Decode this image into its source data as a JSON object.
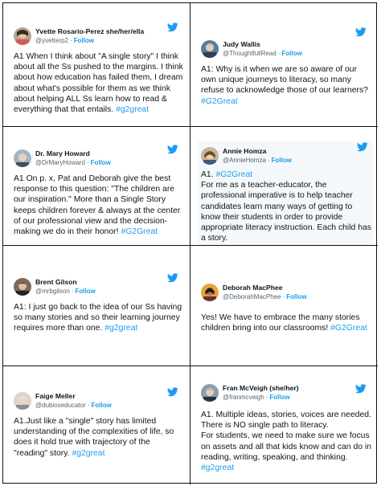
{
  "colors": {
    "link": "#1d9bf0",
    "handle": "#536471",
    "text": "#0f1419",
    "shaded_bg": "#f5f8fa"
  },
  "icons": {
    "brand": "twitter-bird-icon"
  },
  "follow_label": "Follow",
  "tweets": [
    {
      "name": "Yvette Rosario-Perez she/her/ella",
      "handle": "@yvetterp2",
      "body": "A1 When I think about \"A single story\" I think about all the Ss pushed to the margins. I think about how education has failed them, I dream about what's possible for them as we think about helping ALL Ss learn how to read & everything that that entails.",
      "tag": "#g2great"
    },
    {
      "name": "Judy Wallis",
      "handle": "@ThoughtfullRead",
      "body": "A1: Why is it when we are so aware of our own unique journeys to literacy, so many refuse to acknowledge those of our learners?",
      "tag": "#G2Great"
    },
    {
      "name": "Dr. Mary Howard",
      "handle": "@DrMaryHoward",
      "body": "A1 On p. x, Pat and Deborah give the best response to this question: \"The children are our inspiration.\" More than a Single Story keeps children forever & always at the center of our professional view and the decision-making we do in their honor!",
      "tag": "#G2Great"
    },
    {
      "name": "Annie Homza",
      "handle": "@AnnieHomza",
      "lead": "A1.",
      "tag": "#G2Great",
      "body": "For me as a teacher-educator, the professional imperative is to help teacher candidates learn many ways of getting to know their students in order to provide appropriate literacy instruction. Each child has a story."
    },
    {
      "name": "Brent Gilson",
      "handle": "@mrbgilson",
      "body": "A1: I just go back to the idea of our Ss having so many stories and so their learning journey requires more than one.",
      "tag": "#g2great"
    },
    {
      "name": "Deborah MacPhee",
      "handle": "@DeborahMacPhee",
      "body": "Yes! We have to embrace the many stories children bring into our classrooms!",
      "tag": "#G2Great"
    },
    {
      "name": "Faige Meller",
      "handle": "@dubioseducator",
      "body": "A1.Just like a \"single\" story has limited understanding of the complexities of life, so does it hold true with trajectory of the \"reading\" story.",
      "tag": "#g2great"
    },
    {
      "name": "Fran McVeigh (she/her)",
      "handle": "@franmcveigh",
      "body": "A1. Multiple ideas, stories, voices are needed. There is NO single path to literacy.\nFor students, we need to make sure we focus on assets and all that kids know and can do in reading, writing, speaking, and thinking.",
      "tag": "#g2great"
    }
  ]
}
